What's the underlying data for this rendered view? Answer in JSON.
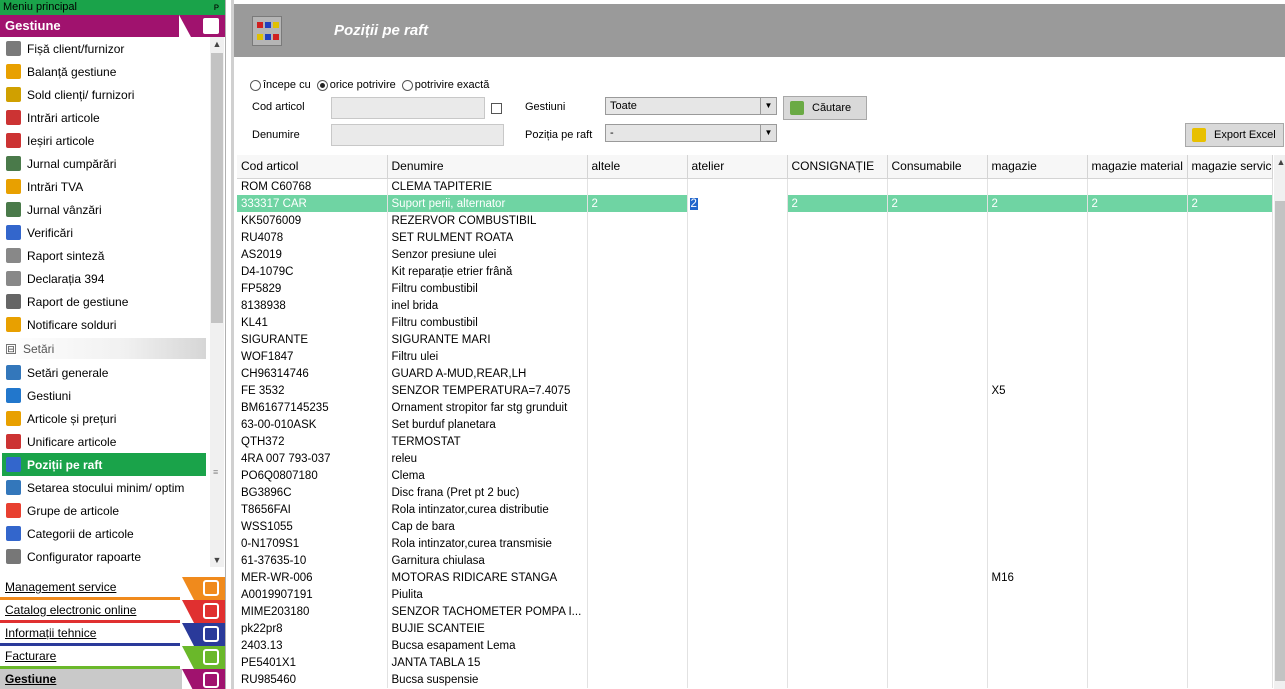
{
  "menu": {
    "header": "Meniu principal",
    "pin": "ᴘ",
    "top_section": "Gestiune",
    "items": [
      {
        "label": "Fișă client/furnizor",
        "icon": "card-icon",
        "color": "#7a7a7a"
      },
      {
        "label": "Balanță gestiune",
        "icon": "scales-icon",
        "color": "#e8a000"
      },
      {
        "label": "Sold clienți/ furnizori",
        "icon": "coins-icon",
        "color": "#d0a000"
      },
      {
        "label": "Intrări articole",
        "icon": "arrow-in-icon",
        "color": "#cc3333"
      },
      {
        "label": "Ieșiri articole",
        "icon": "arrow-out-icon",
        "color": "#cc3333"
      },
      {
        "label": "Jurnal cumpărări",
        "icon": "journal-icon",
        "color": "#4a7a4a"
      },
      {
        "label": "Intrări TVA",
        "icon": "tax-icon",
        "color": "#e8a000"
      },
      {
        "label": "Jurnal vânzări",
        "icon": "journal-sales-icon",
        "color": "#4a7a4a"
      },
      {
        "label": "Verificări",
        "icon": "check-icon",
        "color": "#3366cc"
      },
      {
        "label": "Raport sinteză",
        "icon": "report-icon",
        "color": "#888888"
      },
      {
        "label": "Declarația 394",
        "icon": "declaration-icon",
        "color": "#888888"
      },
      {
        "label": "Raport de gestiune",
        "icon": "euro-icon",
        "color": "#666666"
      },
      {
        "label": "Notificare solduri",
        "icon": "bell-icon",
        "color": "#e8a000"
      }
    ],
    "group": {
      "label": "Setări",
      "collapse": "⊟"
    },
    "settings_items": [
      {
        "label": "Setări generale",
        "icon": "gear-icon",
        "color": "#3377bb"
      },
      {
        "label": "Gestiuni",
        "icon": "warehouse-icon",
        "color": "#2277cc"
      },
      {
        "label": "Articole și prețuri",
        "icon": "price-tag-icon",
        "color": "#e8a000"
      },
      {
        "label": "Unificare articole",
        "icon": "merge-icon",
        "color": "#cc3333"
      },
      {
        "label": "Poziții pe raft",
        "icon": "shelf-icon",
        "color": "#3366cc"
      },
      {
        "label": "Setarea stocului minim/ optim",
        "icon": "stock-icon",
        "color": "#3377bb"
      },
      {
        "label": "Grupe de articole",
        "icon": "groups-icon",
        "color": "#e84030"
      },
      {
        "label": "Categorii de articole",
        "icon": "categories-icon",
        "color": "#3366cc"
      },
      {
        "label": "Configurator rapoarte",
        "icon": "configurator-icon",
        "color": "#777777"
      }
    ],
    "active_label": "Poziții pe raft",
    "bottom_sections": [
      {
        "label": "Management service",
        "color": "#f08a1c",
        "icon": "service-icon"
      },
      {
        "label": "Catalog electronic online",
        "color": "#e03030",
        "icon": "catalog-icon"
      },
      {
        "label": "Informații tehnice",
        "color": "#2a3a9a",
        "icon": "info-icon"
      },
      {
        "label": "Facturare",
        "color": "#6ab82a",
        "icon": "invoice-icon"
      },
      {
        "label": "Gestiune",
        "color": "#a0126e",
        "icon": "gestiune-icon"
      }
    ]
  },
  "page": {
    "title": "Poziții pe raft"
  },
  "filters": {
    "match_options": [
      "începe cu",
      "orice potrivire",
      "potrivire exactă"
    ],
    "match_selected": 1,
    "cod_label": "Cod articol",
    "cod_value": "",
    "denumire_label": "Denumire",
    "denumire_value": "",
    "gestiuni_label": "Gestiuni",
    "gestiuni_value": "Toate",
    "pozitia_label": "Poziția pe raft",
    "pozitia_value": "-",
    "search_button": "Căutare",
    "export_button": "Export Excel"
  },
  "grid": {
    "columns": [
      "Cod articol",
      "Denumire",
      "altele",
      "atelier",
      "CONSIGNAȚIE",
      "Consumabile",
      "magazie",
      "magazie material",
      "magazie service"
    ],
    "selected_row": 1,
    "rows": [
      [
        "ROM C60768",
        "CLEMA TAPITERIE",
        "",
        "",
        "",
        "",
        "",
        "",
        ""
      ],
      [
        "333317 CAR",
        "Suport perii, alternator",
        "2",
        "2",
        "2",
        "2",
        "2",
        "2",
        "2"
      ],
      [
        "KK5076009",
        "REZERVOR COMBUSTIBIL",
        "",
        "",
        "",
        "",
        "",
        "",
        ""
      ],
      [
        "RU4078",
        "SET RULMENT ROATA",
        "",
        "",
        "",
        "",
        "",
        "",
        ""
      ],
      [
        "AS2019",
        "Senzor presiune ulei",
        "",
        "",
        "",
        "",
        "",
        "",
        ""
      ],
      [
        "D4-1079C",
        "Kit reparație etrier frână",
        "",
        "",
        "",
        "",
        "",
        "",
        ""
      ],
      [
        "FP5829",
        "Filtru combustibil",
        "",
        "",
        "",
        "",
        "",
        "",
        ""
      ],
      [
        "8138938",
        "inel brida",
        "",
        "",
        "",
        "",
        "",
        "",
        ""
      ],
      [
        "KL41",
        "Filtru combustibil",
        "",
        "",
        "",
        "",
        "",
        "",
        ""
      ],
      [
        "SIGURANTE",
        "SIGURANTE MARI",
        "",
        "",
        "",
        "",
        "",
        "",
        ""
      ],
      [
        "WOF1847",
        "Filtru ulei",
        "",
        "",
        "",
        "",
        "",
        "",
        ""
      ],
      [
        "CH96314746",
        "GUARD A-MUD,REAR,LH",
        "",
        "",
        "",
        "",
        "",
        "",
        ""
      ],
      [
        "FE 3532",
        "SENZOR TEMPERATURA=7.4075",
        "",
        "",
        "",
        "",
        "X5",
        "",
        ""
      ],
      [
        "BM61677145235",
        "Ornament stropitor far stg grunduit",
        "",
        "",
        "",
        "",
        "",
        "",
        ""
      ],
      [
        "63-00-010ASK",
        "Set burduf planetara",
        "",
        "",
        "",
        "",
        "",
        "",
        ""
      ],
      [
        "QTH372",
        "TERMOSTAT",
        "",
        "",
        "",
        "",
        "",
        "",
        ""
      ],
      [
        "4RA 007 793-037",
        "releu",
        "",
        "",
        "",
        "",
        "",
        "",
        ""
      ],
      [
        "PO6Q0807180",
        "Clema",
        "",
        "",
        "",
        "",
        "",
        "",
        ""
      ],
      [
        "BG3896C",
        "Disc frana (Pret pt 2 buc)",
        "",
        "",
        "",
        "",
        "",
        "",
        ""
      ],
      [
        "T8656FAI",
        "Rola intinzator,curea distributie",
        "",
        "",
        "",
        "",
        "",
        "",
        ""
      ],
      [
        "WSS1055",
        "Cap de bara",
        "",
        "",
        "",
        "",
        "",
        "",
        ""
      ],
      [
        "0-N1709S1",
        "Rola intinzator,curea transmisie",
        "",
        "",
        "",
        "",
        "",
        "",
        ""
      ],
      [
        "61-37635-10",
        "Garnitura chiulasa",
        "",
        "",
        "",
        "",
        "",
        "",
        ""
      ],
      [
        "MER-WR-006",
        "MOTORAS RIDICARE STANGA",
        "",
        "",
        "",
        "",
        "M16",
        "",
        ""
      ],
      [
        "A0019907191",
        "Piulita",
        "",
        "",
        "",
        "",
        "",
        "",
        ""
      ],
      [
        "MIME203180",
        "SENZOR  TACHOMETER  POMPA  I...",
        "",
        "",
        "",
        "",
        "",
        "",
        ""
      ],
      [
        "pk22pr8",
        "BUJIE SCANTEIE",
        "",
        "",
        "",
        "",
        "",
        "",
        ""
      ],
      [
        "2403.13",
        "Bucsa esapament Lema",
        "",
        "",
        "",
        "",
        "",
        "",
        ""
      ],
      [
        "PE5401X1",
        "JANTA TABLA 15",
        "",
        "",
        "",
        "",
        "",
        "",
        ""
      ],
      [
        "RU985460",
        "Bucsa suspensie",
        "",
        "",
        "",
        "",
        "",
        "",
        ""
      ]
    ]
  }
}
